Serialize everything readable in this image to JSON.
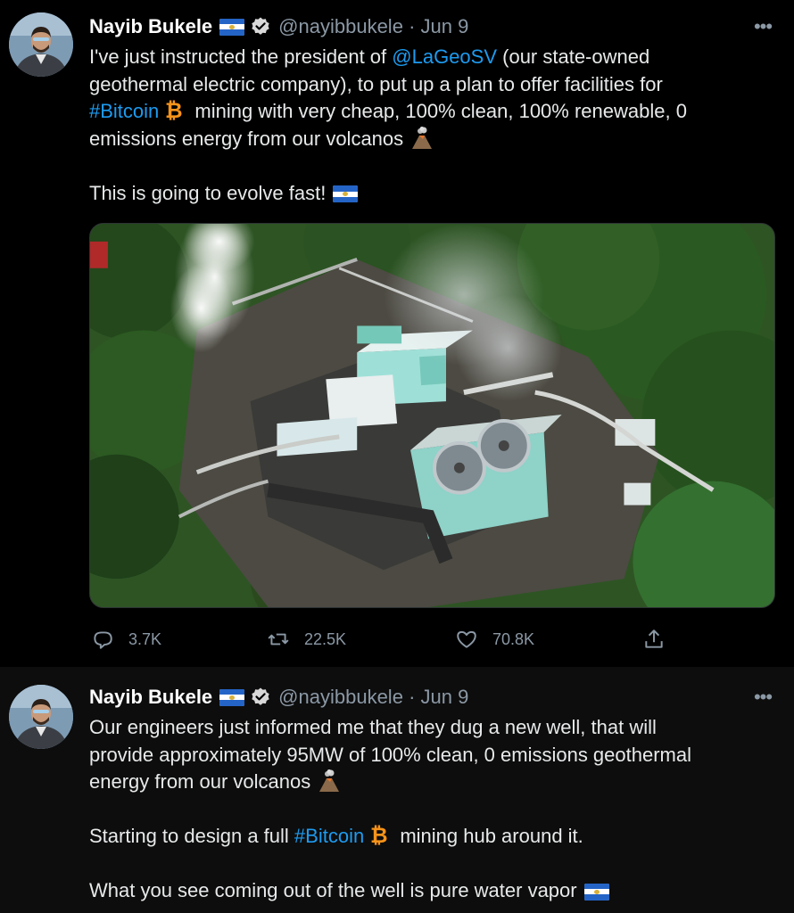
{
  "tweets": [
    {
      "author_name": "Nayib Bukele",
      "handle": "@nayibbukele",
      "separator": "·",
      "date": "Jun 9",
      "text": {
        "l1a": "I've just instructed the president of ",
        "l1_mention": "@LaGeoSV",
        "l1b": " (our state-owned",
        "l2": "geothermal electric company), to put up a plan to offer facilities for",
        "l3_hashtag": "#Bitcoin",
        "l3b": " mining with very cheap, 100% clean, 100% renewable, 0",
        "l4": "emissions energy from our volcanos",
        "l6": "This is going to evolve fast!"
      },
      "stats": {
        "replies": "3.7K",
        "retweets": "22.5K",
        "likes": "70.8K"
      }
    },
    {
      "author_name": "Nayib Bukele",
      "handle": "@nayibbukele",
      "separator": "·",
      "date": "Jun 9",
      "text": {
        "l1": "Our engineers just informed me that they dug a new well, that will",
        "l2": "provide approximately 95MW of 100% clean, 0 emissions geothermal",
        "l3": "energy from our volcanos",
        "l5a": "Starting to design a full ",
        "l5_hashtag": "#Bitcoin",
        "l5b": " mining hub around it.",
        "l7": "What you see coming out of the well is pure water vapor"
      }
    }
  ],
  "icons": {
    "verified": "verified-badge-icon",
    "flag": "el-salvador-flag-icon",
    "bitcoin": "bitcoin-icon",
    "volcano": "volcano-icon",
    "more": "more-icon",
    "reply": "reply-icon",
    "retweet": "retweet-icon",
    "like": "like-icon",
    "share": "share-icon"
  },
  "colors": {
    "background": "#000000",
    "link": "#1d9bf0",
    "muted": "#8b98a5",
    "text": "#e7e9ea"
  }
}
